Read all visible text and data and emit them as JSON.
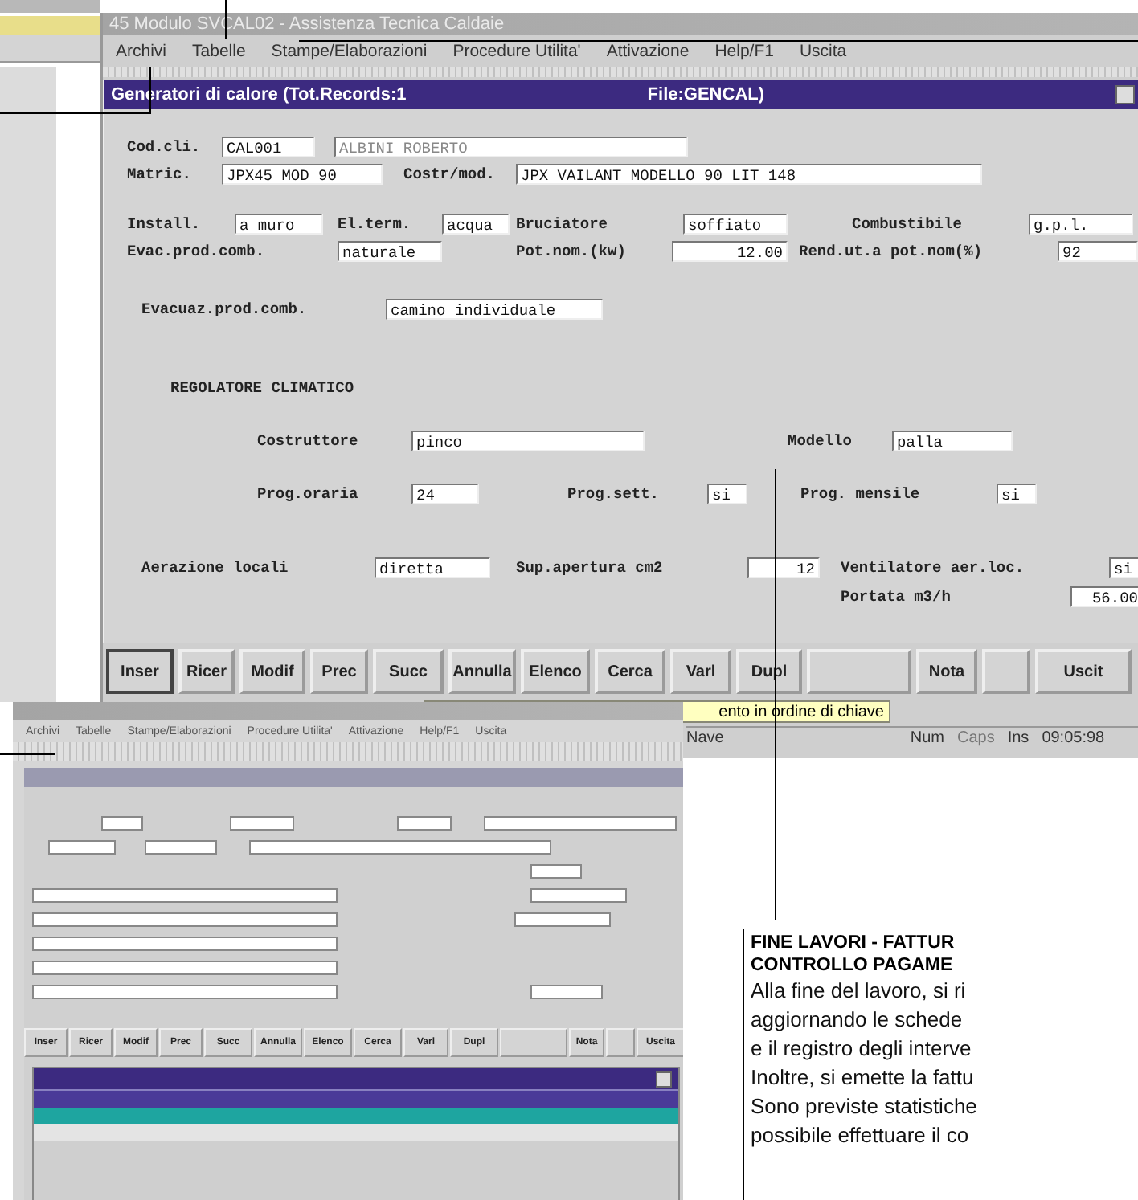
{
  "main_window": {
    "title": "45 Modulo SVCAL02 - Assistenza Tecnica Caldaie",
    "menu": [
      "Archivi",
      "Tabelle",
      "Stampe/Elaborazioni",
      "Procedure Utilita'",
      "Attivazione",
      "Help/F1",
      "Uscita"
    ],
    "form": {
      "title": "Generatori di calore (Tot.Records:1",
      "file": "File:GENCAL)",
      "rows": [
        {
          "items": [
            {
              "kind": "label",
              "text": "Cod.cli."
            },
            {
              "kind": "field",
              "value": "CAL001"
            },
            {
              "kind": "field",
              "value": "ALBINI ROBERTO",
              "disabled": true
            }
          ]
        },
        {
          "items": [
            {
              "kind": "label",
              "text": "Matric."
            },
            {
              "kind": "field",
              "value": "JPX45 MOD 90"
            },
            {
              "kind": "label",
              "text": "Costr/mod."
            },
            {
              "kind": "field",
              "value": "JPX VAILANT MODELLO 90 LIT 148"
            }
          ]
        },
        {
          "items": [
            {
              "kind": "label",
              "text": "Install."
            },
            {
              "kind": "field",
              "value": "a muro"
            },
            {
              "kind": "label",
              "text": "El.term."
            },
            {
              "kind": "field",
              "value": "acqua"
            },
            {
              "kind": "label",
              "text": "Bruciatore"
            },
            {
              "kind": "field",
              "value": "soffiato"
            },
            {
              "kind": "label",
              "text": "Combustibile"
            },
            {
              "kind": "field",
              "value": "g.p.l."
            }
          ]
        },
        {
          "items": [
            {
              "kind": "label",
              "text": "Evac.prod.comb."
            },
            {
              "kind": "field",
              "value": "naturale"
            },
            {
              "kind": "label",
              "text": "Pot.nom.(kw)"
            },
            {
              "kind": "number",
              "value": "12.00"
            },
            {
              "kind": "label",
              "text": "Rend.ut.a pot.nom(%)"
            },
            {
              "kind": "field",
              "value": "92"
            }
          ]
        },
        {
          "items": [
            {
              "kind": "label",
              "text": "Evacuaz.prod.comb."
            },
            {
              "kind": "field",
              "value": "camino individuale"
            }
          ]
        },
        {
          "items": [
            {
              "kind": "heading",
              "text": "REGOLATORE CLIMATICO"
            }
          ]
        },
        {
          "items": [
            {
              "kind": "label",
              "text": "Costruttore"
            },
            {
              "kind": "field",
              "value": "pinco"
            },
            {
              "kind": "label",
              "text": "Modello"
            },
            {
              "kind": "field",
              "value": "palla"
            }
          ]
        },
        {
          "items": [
            {
              "kind": "label",
              "text": "Prog.oraria"
            },
            {
              "kind": "field",
              "value": "24"
            },
            {
              "kind": "label",
              "text": "Prog.sett."
            },
            {
              "kind": "field",
              "value": "si"
            },
            {
              "kind": "label",
              "text": "Prog. mensile"
            },
            {
              "kind": "field",
              "value": "si"
            }
          ]
        },
        {
          "items": [
            {
              "kind": "label",
              "text": "Aerazione locali"
            },
            {
              "kind": "field",
              "value": "diretta"
            },
            {
              "kind": "label",
              "text": "Sup.apertura cm2"
            },
            {
              "kind": "number",
              "value": "12"
            },
            {
              "kind": "label",
              "text": "Ventilatore aer.loc."
            },
            {
              "kind": "field",
              "value": "si"
            }
          ]
        },
        {
          "items": [
            {
              "kind": "label",
              "text": "Portata m3/h"
            },
            {
              "kind": "number",
              "value": "56.00"
            }
          ]
        }
      ]
    },
    "buttons": [
      {
        "kind": "text",
        "label": "Inser",
        "selected": true
      },
      {
        "kind": "text",
        "label": "Ricer",
        "selected": false
      },
      {
        "kind": "text",
        "label": "Modif",
        "selected": false
      },
      {
        "kind": "text",
        "label": "Prec",
        "selected": false
      },
      {
        "kind": "text",
        "label": "Succ",
        "selected": false
      },
      {
        "kind": "text",
        "label": "Annulla",
        "selected": false
      },
      {
        "kind": "text",
        "label": "Elenco",
        "selected": false
      },
      {
        "kind": "text",
        "label": "Cerca",
        "selected": false
      },
      {
        "kind": "text",
        "label": "Varl",
        "selected": false
      },
      {
        "kind": "text",
        "label": "Dupl",
        "selected": false
      },
      {
        "kind": "blank",
        "selected": false
      },
      {
        "kind": "text",
        "label": "Nota",
        "selected": false
      },
      {
        "kind": "blank",
        "selected": false
      },
      {
        "kind": "text",
        "label": "Uscit",
        "selected": false
      }
    ],
    "tooltip": "ento in ordine di chiave",
    "status_bar": [
      {
        "text": "Nave",
        "disabled": false
      },
      {
        "text": "Num",
        "disabled": false
      },
      {
        "text": "Caps",
        "disabled": true
      },
      {
        "text": "Ins",
        "disabled": false
      },
      {
        "text": "09:05:98",
        "disabled": false
      }
    ]
  },
  "second_window": {
    "menu": [
      "Archivi",
      "Tabelle",
      "Stampe/Elaborazioni",
      "Procedure Utilita'",
      "Attivazione",
      "Help/F1",
      "Uscita"
    ],
    "buttons": [
      {
        "kind": "text",
        "label": "Inser"
      },
      {
        "kind": "text",
        "label": "Ricer"
      },
      {
        "kind": "text",
        "label": "Modif"
      },
      {
        "kind": "text",
        "label": "Prec"
      },
      {
        "kind": "text",
        "label": "Succ"
      },
      {
        "kind": "text",
        "label": "Annulla"
      },
      {
        "kind": "text",
        "label": "Elenco"
      },
      {
        "kind": "text",
        "label": "Cerca"
      },
      {
        "kind": "text",
        "label": "Varl"
      },
      {
        "kind": "text",
        "label": "Dupl"
      },
      {
        "kind": "blank"
      },
      {
        "kind": "text",
        "label": "Nota"
      },
      {
        "kind": "blank"
      },
      {
        "kind": "text",
        "label": "Uscita"
      }
    ],
    "list": {
      "rows": [
        {
          "selected": true
        },
        {
          "selected": false
        }
      ]
    }
  },
  "article": {
    "heading": [
      "FINE LAVORI - FATTUR",
      "CONTROLLO PAGAME"
    ],
    "lines": [
      "Alla fine del lavoro, si ri",
      "aggiornando le schede",
      "e il registro degli interve",
      "Inoltre, si emette la fattu",
      "Sono previste statistiche",
      "possibile effettuare il co"
    ]
  }
}
